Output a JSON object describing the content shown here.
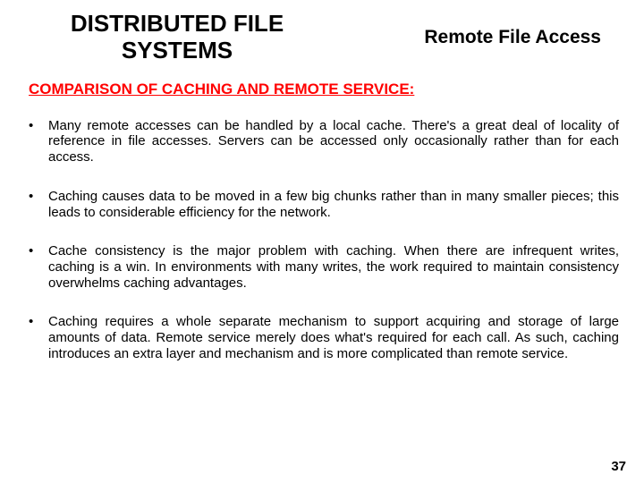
{
  "header": {
    "title": "DISTRIBUTED FILE SYSTEMS",
    "subtitle": "Remote File Access"
  },
  "section_heading": "COMPARISON OF CACHING AND REMOTE SERVICE:",
  "bullets": [
    "Many remote accesses can be handled by a local cache. There's a great deal of locality of reference in file accesses. Servers can be accessed only occasionally rather than for each access.",
    "Caching causes data to be moved in a few big chunks rather than in many smaller pieces; this leads to considerable efficiency for the network.",
    "Cache consistency is the major problem with caching. When there are infrequent writes, caching is a win. In environments with many writes, the work required to maintain consistency overwhelms caching advantages.",
    "Caching requires a whole separate mechanism to support acquiring and storage of large amounts of data. Remote service merely does what's required for each call. As such, caching introduces an extra layer and mechanism and is more complicated than remote service."
  ],
  "page_number": "37"
}
